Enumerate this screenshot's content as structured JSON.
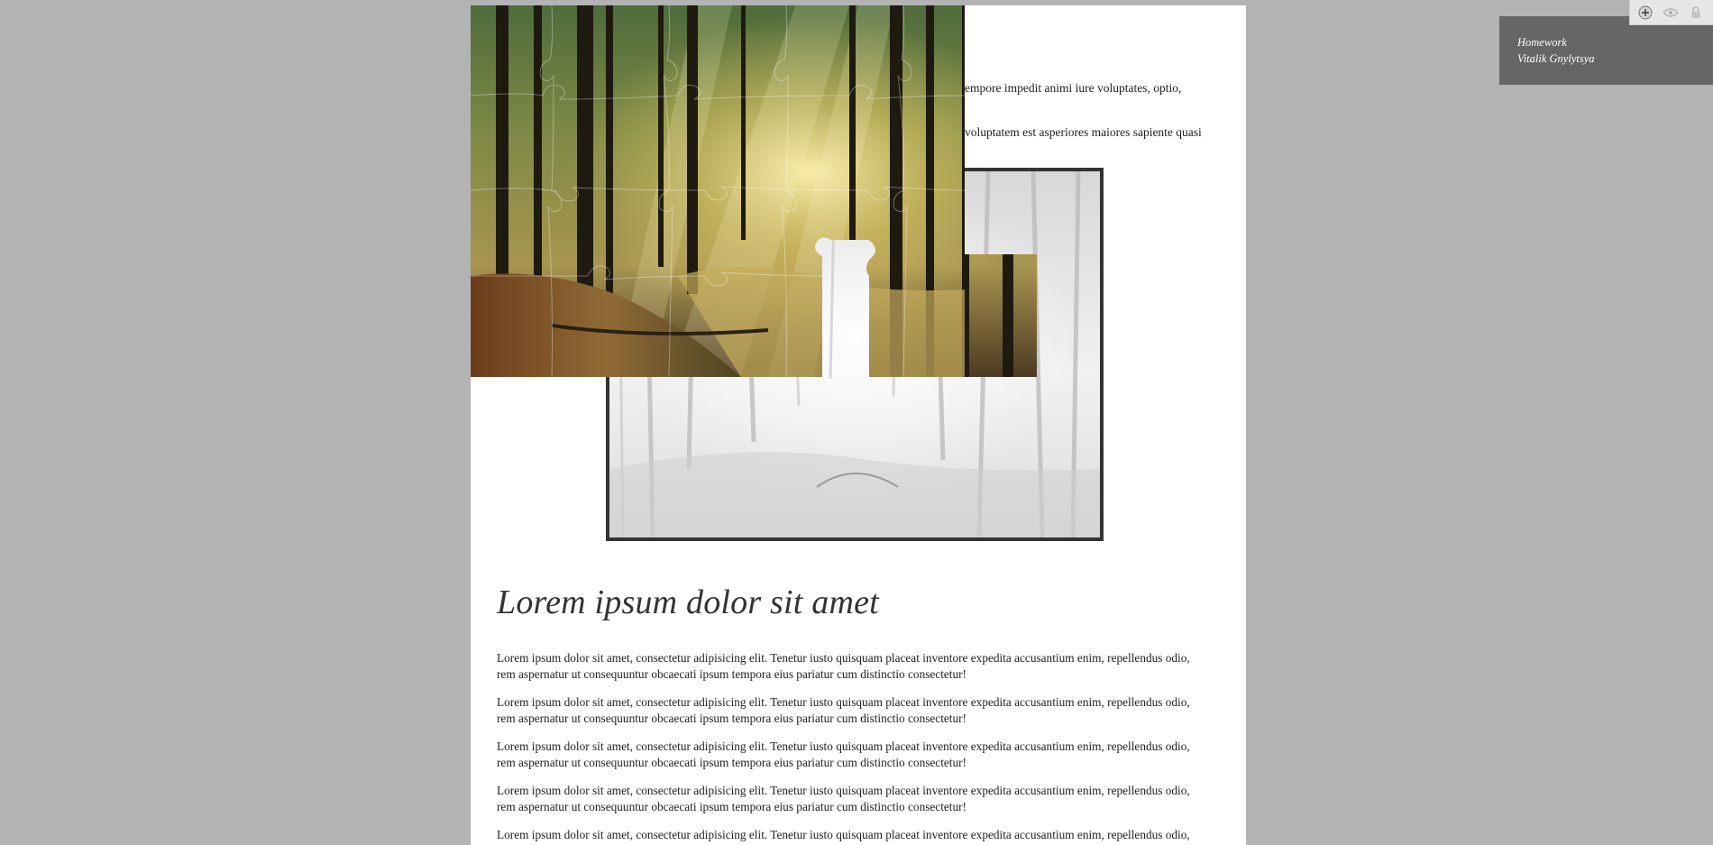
{
  "intro": {
    "line1": "empore impedit animi iure voluptates, optio,",
    "line2": "voluptatem est asperiores maiores sapiente quasi"
  },
  "article": {
    "title": "Lorem ipsum dolor sit amet",
    "paragraphs": [
      "Lorem ipsum dolor sit amet, consectetur adipisicing elit. Tenetur iusto quisquam placeat inventore expedita accusantium enim, repellendus odio, rem aspernatur ut consequuntur obcaecati ipsum tempora eius pariatur cum distinctio consectetur!",
      "Lorem ipsum dolor sit amet, consectetur adipisicing elit. Tenetur iusto quisquam placeat inventore expedita accusantium enim, repellendus odio, rem aspernatur ut consequuntur obcaecati ipsum tempora eius pariatur cum distinctio consectetur!",
      "Lorem ipsum dolor sit amet, consectetur adipisicing elit. Tenetur iusto quisquam placeat inventore expedita accusantium enim, repellendus odio, rem aspernatur ut consequuntur obcaecati ipsum tempora eius pariatur cum distinctio consectetur!",
      "Lorem ipsum dolor sit amet, consectetur adipisicing elit. Tenetur iusto quisquam placeat inventore expedita accusantium enim, repellendus odio, rem aspernatur ut consequuntur obcaecati ipsum tempora eius pariatur cum distinctio consectetur!",
      "Lorem ipsum dolor sit amet, consectetur adipisicing elit. Tenetur iusto quisquam placeat inventore expedita accusantium enim, repellendus odio, rem aspernatur ut consequuntur obcaecati ipsum tempora eius pariatur cum distinctio consectetur!"
    ]
  },
  "credit": {
    "line1": "Homework",
    "line2": "Vitalik Gnylytsya"
  },
  "toolbar": {
    "icons": [
      "plus-icon",
      "eye-icon",
      "lock-icon"
    ]
  },
  "colors": {
    "background": "#b3b3b3",
    "page": "#ffffff",
    "credit_bg": "#666666",
    "frame_border": "#333333"
  }
}
